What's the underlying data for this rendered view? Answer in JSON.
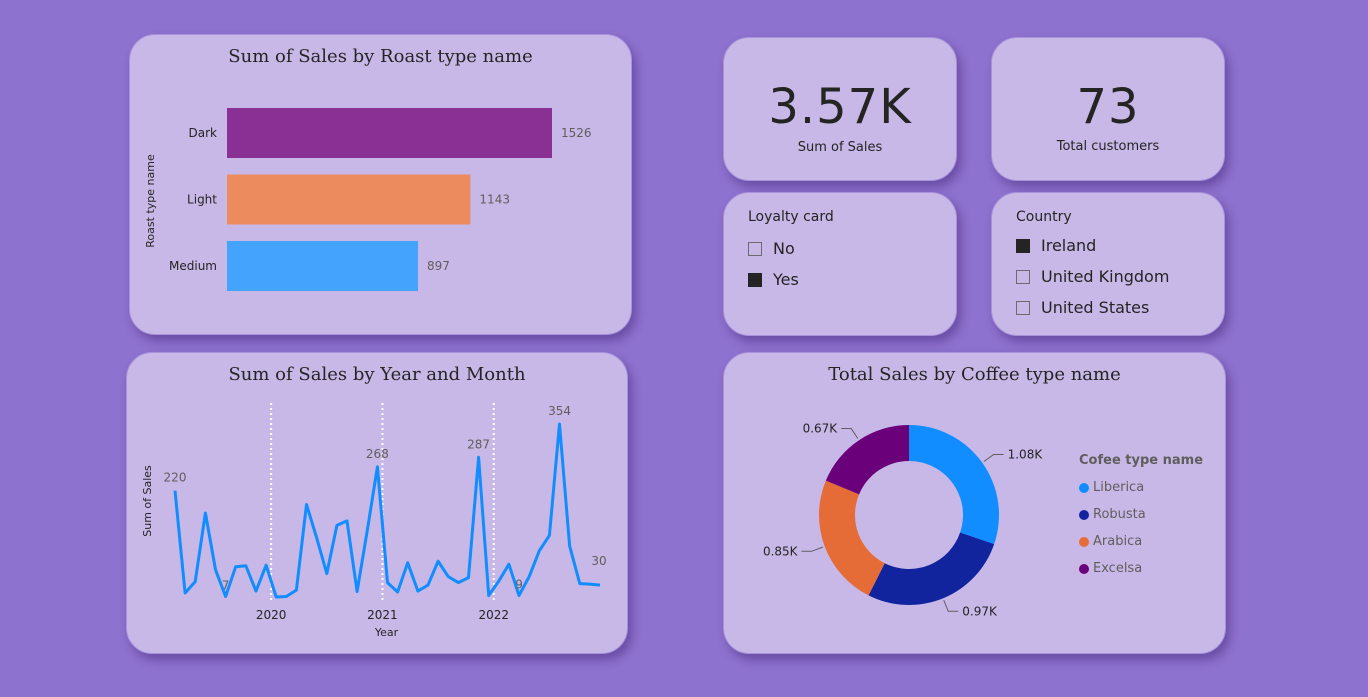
{
  "roast_card": {
    "title": "Sum of Sales by Roast type name",
    "chart_data": {
      "type": "bar",
      "orientation": "horizontal",
      "title": "Sum of Sales by Roast type name",
      "ylabel": "Roast type name",
      "categories": [
        "Dark",
        "Light",
        "Medium"
      ],
      "values": [
        1526,
        1143,
        897
      ],
      "colors": [
        "#8a2f93",
        "#ec8b5e",
        "#43a3fd"
      ],
      "xlim": [
        0,
        1526
      ],
      "data_labels": true
    }
  },
  "trend_card": {
    "title": "Sum of Sales by Year and Month",
    "chart_data": {
      "type": "line",
      "title": "Sum of Sales by Year and Month",
      "xlabel": "Year",
      "ylabel": "Sum of Sales",
      "x_ticks": [
        "2020",
        "2021",
        "2022"
      ],
      "series": [
        {
          "color": "#118dff",
          "values": [
            220,
            14,
            37,
            175,
            61,
            7,
            67,
            69,
            18,
            70,
            6,
            7,
            20,
            192,
            125,
            53,
            150,
            159,
            17,
            140,
            268,
            35,
            16,
            75,
            18,
            30,
            78,
            47,
            35,
            45,
            287,
            9,
            38,
            72,
            9,
            47,
            99,
            130,
            354,
            109,
            33,
            32,
            30
          ]
        }
      ],
      "data_labels": [
        {
          "index": 0,
          "text": "220"
        },
        {
          "index": 5,
          "text": "7"
        },
        {
          "index": 20,
          "text": "268"
        },
        {
          "index": 30,
          "text": "287"
        },
        {
          "index": 34,
          "text": "9"
        },
        {
          "index": 38,
          "text": "354"
        },
        {
          "index": 42,
          "text": "30"
        }
      ],
      "ylim": [
        0,
        354
      ]
    }
  },
  "kpi_sales": {
    "value": "3.57K",
    "label": "Sum of Sales"
  },
  "kpi_customers": {
    "value": "73",
    "label": "Total customers"
  },
  "loyalty_slicer": {
    "title": "Loyalty card",
    "items": [
      {
        "label": "No",
        "checked": false
      },
      {
        "label": "Yes",
        "checked": true
      }
    ]
  },
  "country_slicer": {
    "title": "Country",
    "items": [
      {
        "label": "Ireland",
        "checked": true
      },
      {
        "label": "United Kingdom",
        "checked": false
      },
      {
        "label": "United States",
        "checked": false
      }
    ]
  },
  "coffee_card": {
    "title": "Total Sales by Coffee type name",
    "legend_title": "Cofee type name",
    "chart_data": {
      "type": "pie",
      "variant": "donut",
      "title": "Total Sales by Coffee type name",
      "legend_title": "Cofee type name",
      "legend_position": "right",
      "categories": [
        "Liberica",
        "Robusta",
        "Arabica",
        "Excelsa"
      ],
      "values": [
        1.08,
        0.97,
        0.85,
        0.67
      ],
      "labels": [
        "1.08K",
        "0.97K",
        "0.85K",
        "0.67K"
      ],
      "colors": [
        "#118dff",
        "#12239e",
        "#e66c37",
        "#6b007b"
      ]
    }
  }
}
